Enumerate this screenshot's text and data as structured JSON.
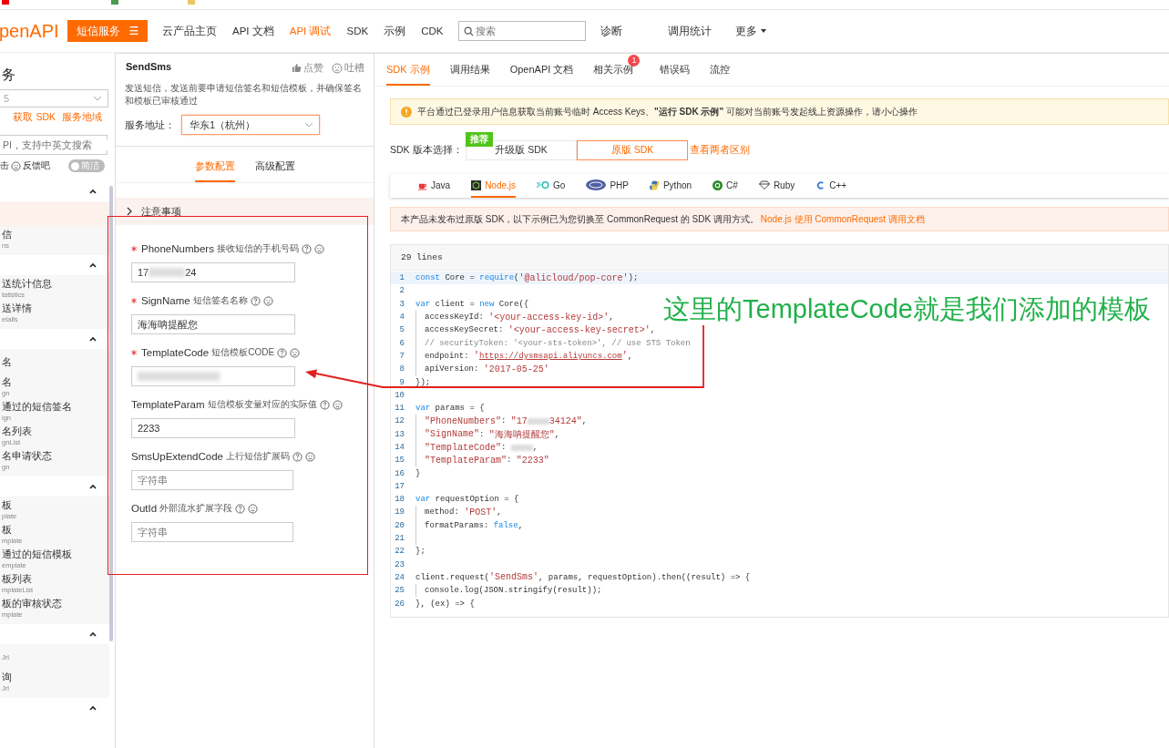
{
  "topnav": {
    "logo": "penAPI",
    "product_button": "短信服务",
    "menu_glyph": "☰",
    "links": [
      {
        "label": "云产品主页",
        "selected": false
      },
      {
        "label": "API 文档",
        "selected": false
      },
      {
        "label": "API 调试",
        "selected": true
      },
      {
        "label": "SDK",
        "selected": false
      },
      {
        "label": "示例",
        "selected": false
      },
      {
        "label": "CDK",
        "selected": false
      }
    ],
    "search": {
      "placeholder": "搜索"
    },
    "right_links": [
      {
        "label": "诊断",
        "dropdown": false
      },
      {
        "label": "调用统计",
        "dropdown": false
      },
      {
        "label": "更多",
        "dropdown": true
      }
    ]
  },
  "sidebar": {
    "title": "务",
    "version_select": {
      "value": "5"
    },
    "links": [
      "获取 SDK",
      "服务地域"
    ],
    "search": {
      "placeholder": "PI，支持中英文搜索"
    },
    "feedback_prefix": "击",
    "feedback": "反馈吧",
    "toggle": {
      "label": "简洁",
      "on": false
    },
    "groups": [
      {
        "expanded": true,
        "items": [
          {
            "selected": true
          },
          {
            "name": "信",
            "sub": "ns",
            "selected": false
          }
        ]
      },
      {
        "expanded": true,
        "items": [
          {
            "name": "送统计信息",
            "sub": "tatistics",
            "selected": false
          },
          {
            "name": "送详情",
            "sub": "etails",
            "selected": false
          }
        ]
      },
      {
        "expanded": true,
        "items": [
          {
            "name": "名",
            "selected": false
          },
          {
            "name": "名",
            "sub": "gn",
            "selected": false
          },
          {
            "name": "通过的短信签名",
            "sub": "ign",
            "selected": false
          },
          {
            "name": "名列表",
            "sub": "gnList",
            "selected": false
          },
          {
            "name": "名申请状态",
            "sub": "gn",
            "selected": false
          }
        ]
      },
      {
        "expanded": true,
        "items": [
          {
            "name": "板",
            "sub": "plate",
            "selected": false
          },
          {
            "name": "板",
            "sub": "mplate",
            "selected": false
          },
          {
            "name": "通过的短信模板",
            "sub": "emplate",
            "selected": false
          },
          {
            "name": "板列表",
            "sub": "mplateList",
            "selected": false
          },
          {
            "name": "板的审核状态",
            "sub": "mplate",
            "selected": false
          }
        ]
      },
      {
        "expanded": true,
        "items": [
          {
            "sub": "Jrl",
            "selected": false
          },
          {
            "name": "询",
            "sub": "Jrl",
            "selected": false
          }
        ]
      },
      {
        "expanded": true
      }
    ]
  },
  "api": {
    "name": "SendSms",
    "like": "点赞",
    "complain": "吐槽",
    "description": "发送短信，发送前要申请短信签名和短信模板，并确保签名和模板已审核通过",
    "endpoint": {
      "label": "服务地址：",
      "value": "华东1（杭州）"
    },
    "tabs": [
      {
        "label": "参数配置",
        "selected": true
      },
      {
        "label": "高级配置",
        "selected": false
      }
    ],
    "notice": {
      "label": "注意事项",
      "expanded": false
    },
    "params": [
      {
        "name": "PhoneNumbers",
        "required": true,
        "desc": "接收短信的手机号码",
        "value": [
          {
            "kind": "text",
            "text": "17"
          },
          {
            "kind": "redacted"
          },
          {
            "kind": "text",
            "text": "24"
          }
        ]
      },
      {
        "name": "SignName",
        "required": true,
        "desc": "短信签名名称",
        "value": [
          {
            "kind": "text",
            "text": "海海呐提醒您"
          }
        ]
      },
      {
        "name": "TemplateCode",
        "required": true,
        "desc": "短信模板CODE",
        "value": [
          {
            "kind": "redacted"
          }
        ]
      },
      {
        "name": "TemplateParam",
        "required": false,
        "desc": "短信模板变量对应的实际值",
        "value": [
          {
            "kind": "text",
            "text": "2233"
          }
        ]
      },
      {
        "name": "SmsUpExtendCode",
        "required": false,
        "desc": "上行短信扩展码",
        "placeholder": "字符串"
      },
      {
        "name": "OutId",
        "required": false,
        "desc": "外部流水扩展字段",
        "placeholder": "字符串"
      }
    ]
  },
  "sdk_panel": {
    "tabs": [
      {
        "label": "SDK 示例",
        "selected": true
      },
      {
        "label": "调用结果",
        "selected": false
      },
      {
        "label": "OpenAPI 文档",
        "selected": false
      },
      {
        "label": "相关示例",
        "selected": false,
        "badge": "1"
      },
      {
        "label": "错误码",
        "selected": false
      },
      {
        "label": "流控",
        "selected": false
      }
    ],
    "warning": "平台通过已登录用户信息获取当前账号临时 Access Keys、**\"运行 SDK 示例\"** 可能对当前账号发起线上资源操作，请小心操作",
    "version": {
      "label": "SDK 版本选择：",
      "options": [
        {
          "label": "升级版 SDK",
          "badge": "推荐",
          "selected": false
        },
        {
          "label": "原版 SDK",
          "selected": true
        }
      ],
      "compare_link": "查看两者区别"
    },
    "languages": [
      {
        "label": "Java",
        "kind": "java",
        "selected": false
      },
      {
        "label": "Node.js",
        "kind": "node",
        "selected": true
      },
      {
        "label": "Go",
        "kind": "go",
        "selected": false
      },
      {
        "label": "PHP",
        "kind": "php",
        "selected": false
      },
      {
        "label": "Python",
        "kind": "python",
        "selected": false
      },
      {
        "label": "C#",
        "kind": "csharp",
        "selected": false
      },
      {
        "label": "Ruby",
        "kind": "ruby",
        "selected": false
      },
      {
        "label": "C++",
        "kind": "cpp",
        "selected": false
      }
    ],
    "notice": {
      "text": "本产品未发布过原版 SDK，以下示例已为您切换至 CommonRequest 的 SDK 调用方式。",
      "link": "Node.js 使用 CommonRequest 调用文档"
    },
    "code": {
      "header": "29 lines",
      "lines": [
        {
          "number": "1",
          "highlighted": true,
          "segments": [
            {
              "kind": "kw",
              "text": "const"
            },
            {
              "kind": "plain",
              "text": " Core = "
            },
            {
              "kind": "kw",
              "text": "require"
            },
            {
              "kind": "plain",
              "text": "("
            },
            {
              "kind": "str",
              "text": "'@alicloud/pop-core'"
            },
            {
              "kind": "plain",
              "text": ");"
            }
          ]
        },
        {
          "number": "2",
          "highlighted": false
        },
        {
          "number": "3",
          "highlighted": false,
          "segments": [
            {
              "kind": "kw",
              "text": "var"
            },
            {
              "kind": "plain",
              "text": " client = "
            },
            {
              "kind": "kw",
              "text": "new"
            },
            {
              "kind": "plain",
              "text": " Core({"
            }
          ]
        },
        {
          "number": "4",
          "highlighted": false,
          "indent": true,
          "segments": [
            {
              "kind": "plain",
              "text": "accessKeyId: "
            },
            {
              "kind": "str",
              "text": "'<your-access-key-id>'"
            },
            {
              "kind": "plain",
              "text": ","
            }
          ]
        },
        {
          "number": "5",
          "highlighted": false,
          "indent": true,
          "segments": [
            {
              "kind": "plain",
              "text": "accessKeySecret: "
            },
            {
              "kind": "str",
              "text": "'<your-access-key-secret>'"
            },
            {
              "kind": "plain",
              "text": ","
            }
          ]
        },
        {
          "number": "6",
          "highlighted": false,
          "indent": true,
          "segments": [
            {
              "kind": "comment",
              "text": "// securityToken: '<your-sts-token>', // use STS Token"
            }
          ]
        },
        {
          "number": "7",
          "highlighted": false,
          "indent": true,
          "segments": [
            {
              "kind": "plain",
              "text": "endpoint: "
            },
            {
              "kind": "str",
              "text": "'"
            },
            {
              "kind": "link",
              "text": "https://dysmsapi.aliyuncs.com"
            },
            {
              "kind": "str",
              "text": "'"
            },
            {
              "kind": "plain",
              "text": ","
            }
          ]
        },
        {
          "number": "8",
          "highlighted": false,
          "indent": true,
          "segments": [
            {
              "kind": "plain",
              "text": "apiVersion: "
            },
            {
              "kind": "str",
              "text": "'2017-05-25'"
            }
          ]
        },
        {
          "number": "9",
          "highlighted": false,
          "segments": [
            {
              "kind": "plain",
              "text": "});"
            }
          ]
        },
        {
          "number": "10",
          "highlighted": false
        },
        {
          "number": "11",
          "highlighted": false,
          "segments": [
            {
              "kind": "kw",
              "text": "var"
            },
            {
              "kind": "plain",
              "text": " params = {"
            }
          ]
        },
        {
          "number": "12",
          "highlighted": false,
          "indent": true,
          "segments": [
            {
              "kind": "str",
              "text": "\"PhoneNumbers\""
            },
            {
              "kind": "plain",
              "text": ": "
            },
            {
              "kind": "str",
              "text": "\"17"
            },
            {
              "kind": "redacted"
            },
            {
              "kind": "str",
              "text": "34124\""
            },
            {
              "kind": "plain",
              "text": ","
            }
          ]
        },
        {
          "number": "13",
          "highlighted": false,
          "indent": true,
          "segments": [
            {
              "kind": "str",
              "text": "\"SignName\""
            },
            {
              "kind": "plain",
              "text": ": "
            },
            {
              "kind": "str",
              "text": "\"海海呐提醒您\""
            },
            {
              "kind": "plain",
              "text": ","
            }
          ]
        },
        {
          "number": "14",
          "highlighted": false,
          "indent": true,
          "segments": [
            {
              "kind": "str",
              "text": "\"TemplateCode\""
            },
            {
              "kind": "plain",
              "text": ": "
            },
            {
              "kind": "redacted"
            },
            {
              "kind": "plain",
              "text": ","
            }
          ]
        },
        {
          "number": "15",
          "highlighted": false,
          "indent": true,
          "segments": [
            {
              "kind": "str",
              "text": "\"TemplateParam\""
            },
            {
              "kind": "plain",
              "text": ": "
            },
            {
              "kind": "str",
              "text": "\"2233\""
            }
          ]
        },
        {
          "number": "16",
          "highlighted": false,
          "segments": [
            {
              "kind": "plain",
              "text": "}"
            }
          ]
        },
        {
          "number": "17",
          "highlighted": false
        },
        {
          "number": "18",
          "highlighted": false,
          "segments": [
            {
              "kind": "kw",
              "text": "var"
            },
            {
              "kind": "plain",
              "text": " requestOption = {"
            }
          ]
        },
        {
          "number": "19",
          "highlighted": false,
          "indent": true,
          "segments": [
            {
              "kind": "plain",
              "text": "method: "
            },
            {
              "kind": "str",
              "text": "'POST'"
            },
            {
              "kind": "plain",
              "text": ","
            }
          ]
        },
        {
          "number": "20",
          "highlighted": false,
          "indent": true,
          "segments": [
            {
              "kind": "plain",
              "text": "formatParams: "
            },
            {
              "kind": "kw",
              "text": "false"
            },
            {
              "kind": "plain",
              "text": ","
            }
          ]
        },
        {
          "number": "21",
          "highlighted": false,
          "indent": true
        },
        {
          "number": "22",
          "highlighted": false,
          "segments": [
            {
              "kind": "plain",
              "text": "};"
            }
          ]
        },
        {
          "number": "23",
          "highlighted": false
        },
        {
          "number": "24",
          "highlighted": false,
          "segments": [
            {
              "kind": "plain",
              "text": "client.request("
            },
            {
              "kind": "str",
              "text": "'SendSms'"
            },
            {
              "kind": "plain",
              "text": ", params, requestOption).then((result) => {"
            }
          ]
        },
        {
          "number": "25",
          "highlighted": false,
          "indent": true,
          "segments": [
            {
              "kind": "plain",
              "text": "console.log(JSON.stringify(result));"
            }
          ]
        },
        {
          "number": "26",
          "highlighted": false,
          "segments": [
            {
              "kind": "plain",
              "text": "}, (ex) => {"
            }
          ]
        }
      ]
    }
  },
  "annotation": {
    "text": "这里的TemplateCode就是我们添加的模板"
  }
}
